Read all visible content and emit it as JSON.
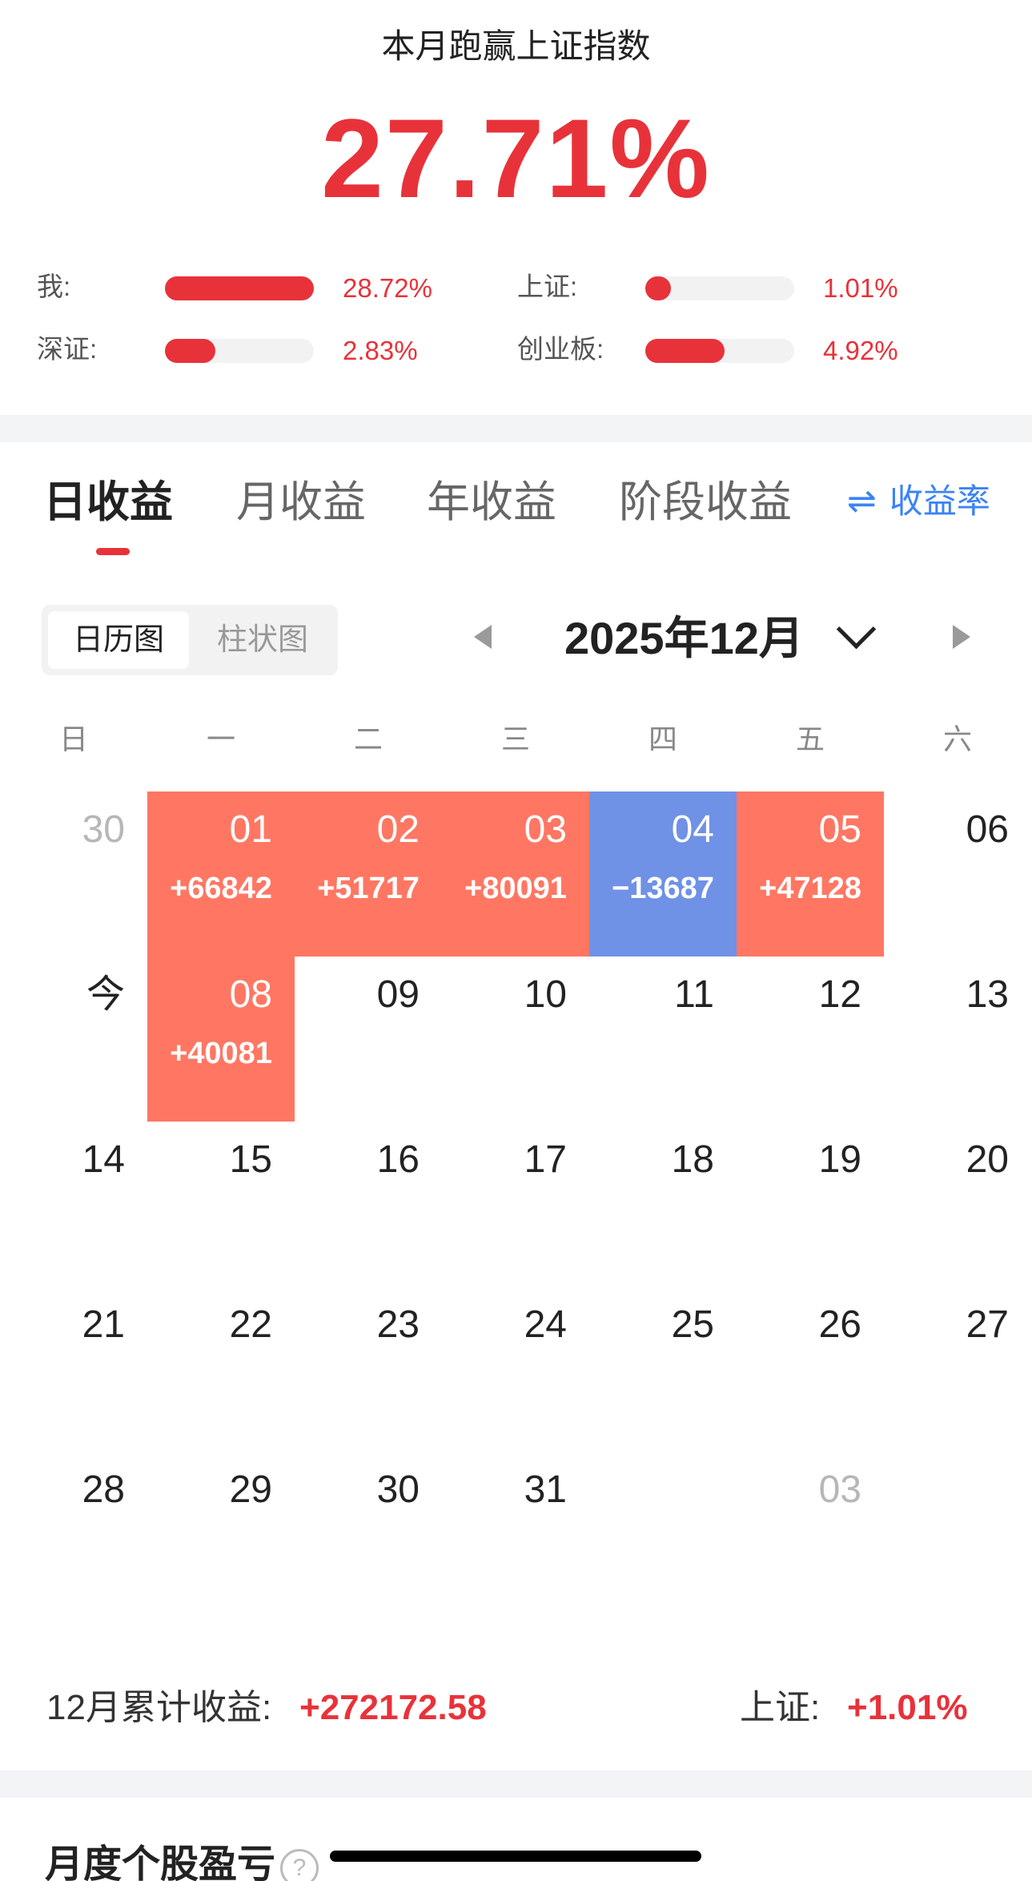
{
  "summary": {
    "title": "本月跑赢上证指数",
    "value": "27.71%",
    "comparisons": [
      {
        "label": "我:",
        "pct": "28.72%",
        "fill": 1.0
      },
      {
        "label": "上证:",
        "pct": "1.01%",
        "fill": 0.17
      },
      {
        "label": "深证:",
        "pct": "2.83%",
        "fill": 0.34
      },
      {
        "label": "创业板:",
        "pct": "4.92%",
        "fill": 0.53
      }
    ]
  },
  "tabs": [
    "日收益",
    "月收益",
    "年收益",
    "阶段收益"
  ],
  "rate_toggle": {
    "icon": "⇌",
    "label": "收益率"
  },
  "view_switch": {
    "active": "日历图",
    "inactive": "柱状图"
  },
  "month": "2025年12月",
  "weekdays": [
    "日",
    "一",
    "二",
    "三",
    "四",
    "五",
    "六"
  ],
  "calendar": {
    "rows": [
      [
        {
          "day": "30",
          "muted": true
        },
        {
          "day": "01",
          "amount": "+66842",
          "type": "gain"
        },
        {
          "day": "02",
          "amount": "+51717",
          "type": "gain"
        },
        {
          "day": "03",
          "amount": "+80091",
          "type": "gain"
        },
        {
          "day": "04",
          "amount": "−13687",
          "type": "loss"
        },
        {
          "day": "05",
          "amount": "+47128",
          "type": "gain"
        },
        {
          "day": "06"
        }
      ],
      [
        {
          "day": "今"
        },
        {
          "day": "08",
          "amount": "+40081",
          "type": "gain"
        },
        {
          "day": "09"
        },
        {
          "day": "10"
        },
        {
          "day": "11"
        },
        {
          "day": "12"
        },
        {
          "day": "13"
        }
      ],
      [
        {
          "day": "14"
        },
        {
          "day": "15"
        },
        {
          "day": "16"
        },
        {
          "day": "17"
        },
        {
          "day": "18"
        },
        {
          "day": "19"
        },
        {
          "day": "20"
        }
      ],
      [
        {
          "day": "21"
        },
        {
          "day": "22"
        },
        {
          "day": "23"
        },
        {
          "day": "24"
        },
        {
          "day": "25"
        },
        {
          "day": "26"
        },
        {
          "day": "27"
        }
      ],
      [
        {
          "day": "28"
        },
        {
          "day": "29"
        },
        {
          "day": "30"
        },
        {
          "day": "31"
        },
        {
          "day": ""
        },
        {
          "day": "03",
          "muted": true
        },
        {
          "day": ""
        }
      ]
    ]
  },
  "footer": {
    "month_total_label": "12月累计收益:",
    "month_total_value": "+272172.58",
    "index_label": "上证:",
    "index_value": "+1.01%"
  },
  "next_section": {
    "title": "月度个股盈亏",
    "help_icon": "?"
  },
  "colors": {
    "red": "#e8323a",
    "gain_cell": "#ff7763",
    "loss_cell": "#6f91e6",
    "blue": "#3b83f6"
  }
}
